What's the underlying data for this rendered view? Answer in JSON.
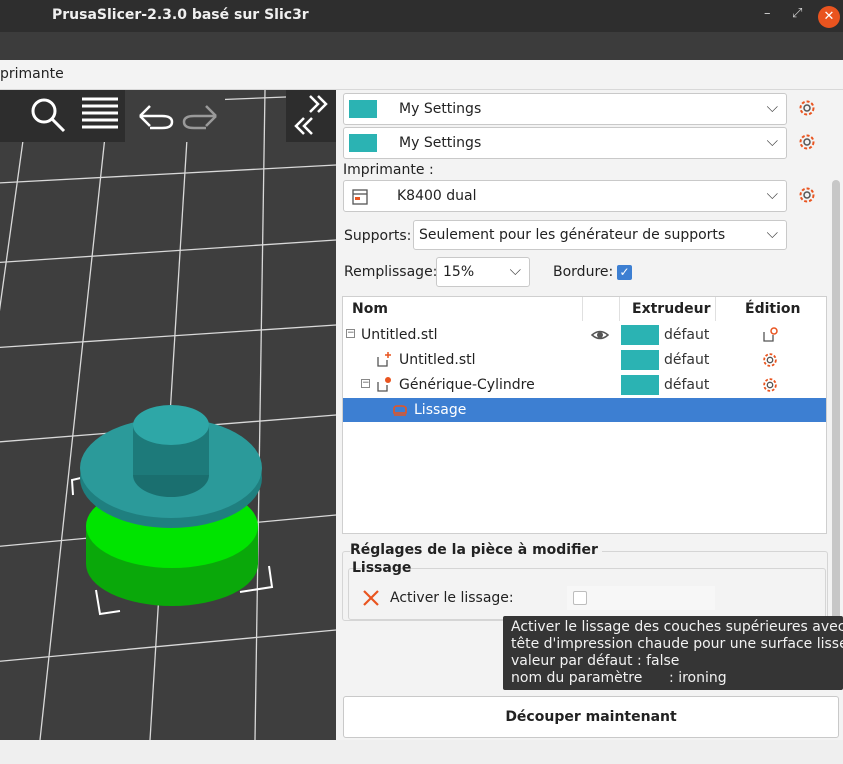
{
  "window": {
    "title": "PrusaSlicer-2.3.0 basé sur Slic3r",
    "minimize": "–",
    "restore": "⤢",
    "close": "✕"
  },
  "menu": {
    "tab": "primante"
  },
  "presets": {
    "print": "My Settings",
    "filament": "My Settings",
    "printer_label": "Imprimante :",
    "printer": "K8400 dual",
    "supports_label": "Supports:",
    "supports_value": "Seulement pour les générateur de supports",
    "infill_label": "Remplissage:",
    "infill_value": "15%",
    "brim_label": "Bordure:",
    "brim_checked": true
  },
  "object_list": {
    "columns": {
      "name": "Nom",
      "extruder": "Extrudeur",
      "edit": "Édition"
    },
    "rows": [
      {
        "name": "Untitled.stl",
        "extruder": "défaut"
      },
      {
        "name": "Untitled.stl",
        "extruder": "défaut"
      },
      {
        "name": "Générique-Cylindre",
        "extruder": "défaut"
      },
      {
        "name": "Lissage"
      }
    ]
  },
  "part_settings": {
    "group": "Réglages de la pièce à modifier",
    "subgroup": "Lissage",
    "option": "Activer le lissage:"
  },
  "tooltip": {
    "line1": "Activer le lissage des couches supérieures avec la",
    "line2": "tête d'impression chaude pour une surface lisse",
    "line3": "valeur par défaut : false",
    "line4": "nom du paramètre      : ironing"
  },
  "slice_button": "Découper maintenant",
  "colors": {
    "accent": "#2bb3b3",
    "selection": "#3d7fd2",
    "close": "#e9541f",
    "warning": "#e9541f"
  }
}
